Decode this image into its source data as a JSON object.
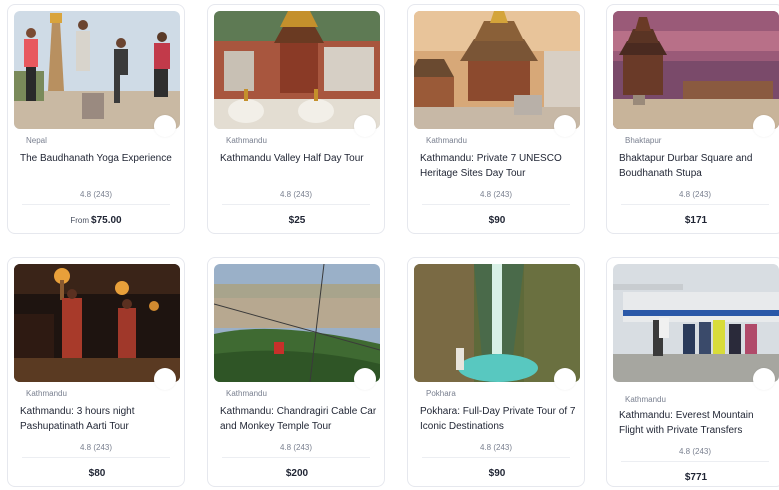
{
  "tours": [
    {
      "location": "Nepal",
      "title": "The Baudhanath Yoga Experience",
      "rating": "4.8 (243)",
      "price_prefix": "From",
      "price": "$75.00"
    },
    {
      "location": "Kathmandu",
      "title": "Kathmandu Valley Half Day Tour",
      "rating": "4.8 (243)",
      "price_prefix": "",
      "price": "$25"
    },
    {
      "location": "Kathmandu",
      "title": "Kathmandu: Private 7 UNESCO Heritage Sites Day Tour",
      "rating": "4.8 (243)",
      "price_prefix": "",
      "price": "$90"
    },
    {
      "location": "Bhaktapur",
      "title": "Bhaktapur Durbar Square and Boudhanath Stupa",
      "rating": "4.8 (243)",
      "price_prefix": "",
      "price": "$171"
    },
    {
      "location": "Kathmandu",
      "title": "Kathmandu: 3 hours night Pashupatinath Aarti Tour",
      "rating": "4.8 (243)",
      "price_prefix": "",
      "price": "$80"
    },
    {
      "location": "Kathmandu",
      "title": "Kathmandu: Chandragiri Cable Car and Monkey Temple Tour",
      "rating": "4.8 (243)",
      "price_prefix": "",
      "price": "$200"
    },
    {
      "location": "Pokhara",
      "title": "Pokhara: Full-Day Private Tour of 7 Iconic Destinations",
      "rating": "4.8 (243)",
      "price_prefix": "",
      "price": "$90"
    },
    {
      "location": "Kathmandu",
      "title": "Kathmandu: Everest Mountain Flight with Private Transfers",
      "rating": "4.8 (243)",
      "price_prefix": "",
      "price": "$771"
    }
  ]
}
